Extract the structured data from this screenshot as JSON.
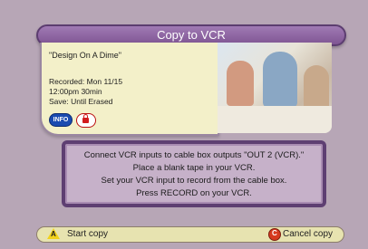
{
  "header": {
    "title": "Copy to VCR"
  },
  "program": {
    "title": "\"Design On A Dime\"",
    "recorded": "Recorded: Mon 11/15",
    "time": "12:00pm  30min",
    "save": "Save: Until Erased",
    "info_badge": "INFO"
  },
  "instructions": [
    "Connect VCR inputs to cable box outputs \"OUT 2 (VCR).\"",
    "Place a blank tape in your VCR.",
    "Set your VCR input to record from the cable box.",
    "Press RECORD on your VCR."
  ],
  "footer": {
    "start_key": "A",
    "start_label": "Start copy",
    "cancel_key": "C",
    "cancel_label": "Cancel copy"
  },
  "colors": {
    "accent": "#7f5593",
    "background": "#b7a6b6",
    "card": "#f3f0c9"
  }
}
